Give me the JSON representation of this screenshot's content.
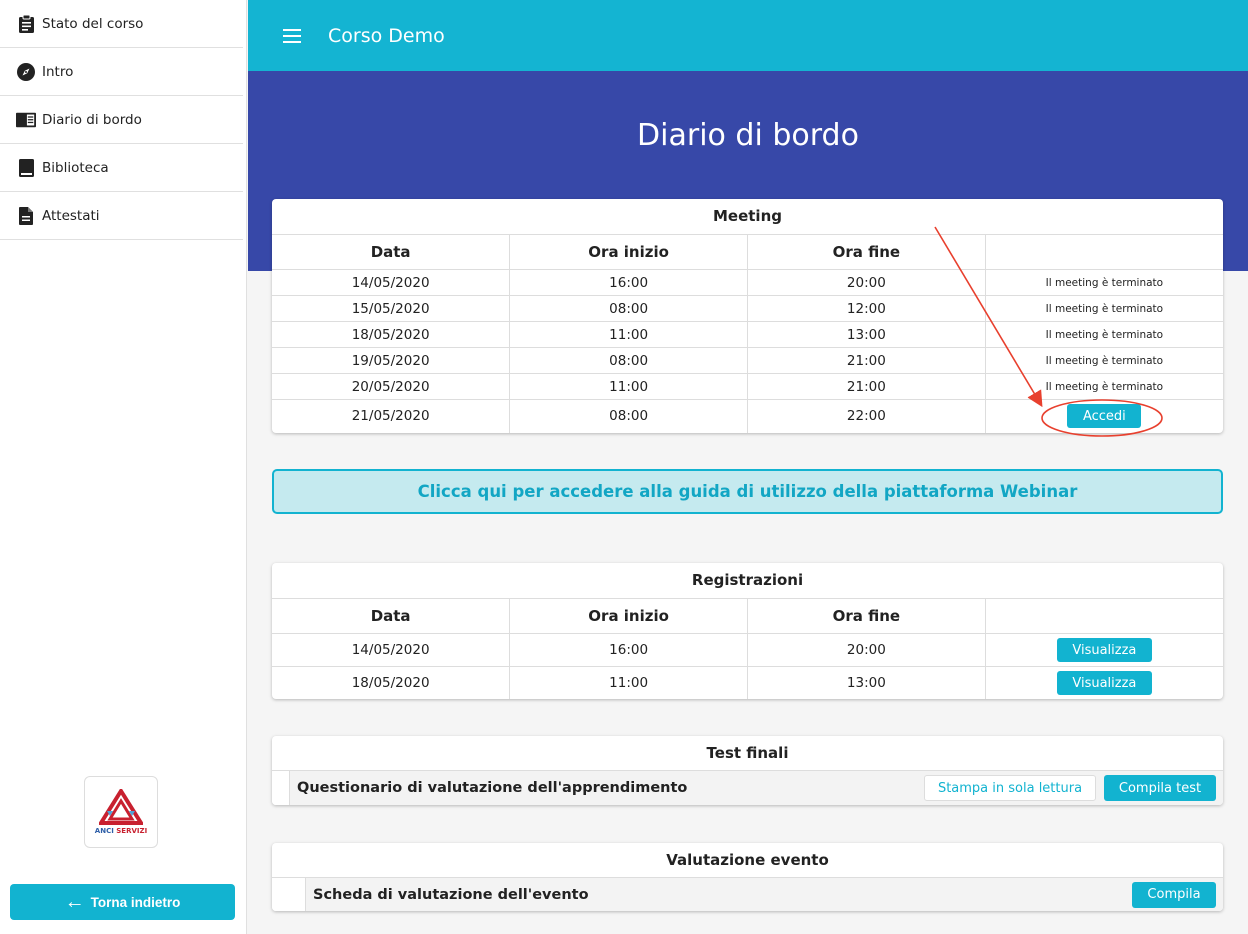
{
  "sidebar": {
    "items": [
      {
        "label": "Stato del corso",
        "icon": "clipboard-icon"
      },
      {
        "label": "Intro",
        "icon": "compass-icon"
      },
      {
        "label": "Diario di bordo",
        "icon": "book-open-icon"
      },
      {
        "label": "Biblioteca",
        "icon": "book-icon"
      },
      {
        "label": "Attestati",
        "icon": "document-icon"
      }
    ],
    "logo_text_part1": "ANCI",
    "logo_text_part2": " SERVIZI",
    "back_label": "Torna indietro"
  },
  "header": {
    "title": "Corso Demo"
  },
  "hero": {
    "title": "Diario di bordo"
  },
  "meeting": {
    "title": "Meeting",
    "columns": [
      "Data",
      "Ora inizio",
      "Ora fine",
      ""
    ],
    "rows": [
      {
        "date": "14/05/2020",
        "start": "16:00",
        "end": "20:00",
        "status": "Il meeting è terminato"
      },
      {
        "date": "15/05/2020",
        "start": "08:00",
        "end": "12:00",
        "status": "Il meeting è terminato"
      },
      {
        "date": "18/05/2020",
        "start": "11:00",
        "end": "13:00",
        "status": "Il meeting è terminato"
      },
      {
        "date": "19/05/2020",
        "start": "08:00",
        "end": "21:00",
        "status": "Il meeting è terminato"
      },
      {
        "date": "20/05/2020",
        "start": "11:00",
        "end": "21:00",
        "status": "Il meeting è terminato"
      },
      {
        "date": "21/05/2020",
        "start": "08:00",
        "end": "22:00",
        "button": "Accedi"
      }
    ]
  },
  "guide": {
    "label": "Clicca qui per accedere alla guida di utilizzo della piattaforma Webinar"
  },
  "registrazioni": {
    "title": "Registrazioni",
    "columns": [
      "Data",
      "Ora inizio",
      "Ora fine",
      ""
    ],
    "rows": [
      {
        "date": "14/05/2020",
        "start": "16:00",
        "end": "20:00",
        "button": "Visualizza"
      },
      {
        "date": "18/05/2020",
        "start": "11:00",
        "end": "13:00",
        "button": "Visualizza"
      }
    ]
  },
  "test_finali": {
    "title": "Test finali",
    "item": "Questionario di valutazione dell'apprendimento",
    "print_label": "Stampa in sola lettura",
    "compile_label": "Compila test"
  },
  "valutazione": {
    "title": "Valutazione evento",
    "item": "Scheda di valutazione dell'evento",
    "compile_label": "Compila"
  },
  "colors": {
    "accent": "#14b4d2",
    "hero": "#3748a8",
    "annotation": "#e8402e"
  }
}
